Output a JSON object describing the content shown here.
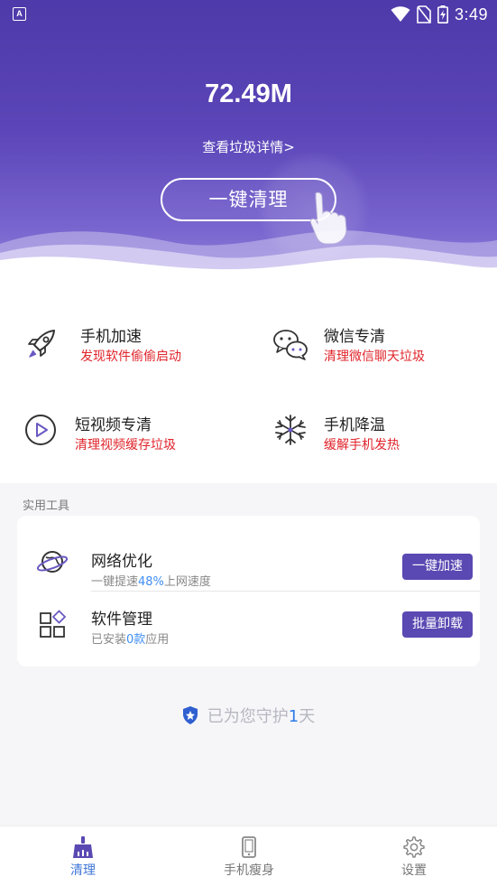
{
  "status_bar": {
    "time": "3:49",
    "app_icon_letter": "A",
    "icons": [
      "wifi-icon",
      "no-sim-icon",
      "battery-charging-icon"
    ]
  },
  "header": {
    "junk_size": "72.49M",
    "detail_link": "查看垃圾详情>",
    "clean_button": "一键清理",
    "gradient_top": "#4e3aa9",
    "gradient_bottom": "#9a8ade"
  },
  "features": [
    {
      "icon": "rocket-icon",
      "title": "手机加速",
      "subtitle": "发现软件偷偷启动"
    },
    {
      "icon": "wechat-icon",
      "title": "微信专清",
      "subtitle": "清理微信聊天垃圾"
    },
    {
      "icon": "play-circle-icon",
      "title": "短视频专清",
      "subtitle": "清理视频缓存垃圾"
    },
    {
      "icon": "snowflake-icon",
      "title": "手机降温",
      "subtitle": "缓解手机发热"
    }
  ],
  "tools": {
    "section_title": "实用工具",
    "items": [
      {
        "icon": "planet-icon",
        "title": "网络优化",
        "sub_before": "一键提速",
        "sub_highlight": "48%",
        "sub_after": "上网速度",
        "button": "一键加速"
      },
      {
        "icon": "apps-grid-icon",
        "title": "软件管理",
        "sub_before": "已安装",
        "sub_highlight": "0款",
        "sub_after": "应用",
        "button": "批量卸载"
      }
    ]
  },
  "protect": {
    "before": "已为您守护",
    "days": "1",
    "after": "天"
  },
  "bottom_nav": [
    {
      "icon": "broom-icon",
      "label": "清理",
      "active": true
    },
    {
      "icon": "phone-icon",
      "label": "手机瘦身",
      "active": false
    },
    {
      "icon": "gear-icon",
      "label": "设置",
      "active": false
    }
  ],
  "colors": {
    "accent": "#5a49b2",
    "warning_text": "#e0242b",
    "highlight": "#3f8ef5",
    "active_nav": "#3f76d8"
  }
}
